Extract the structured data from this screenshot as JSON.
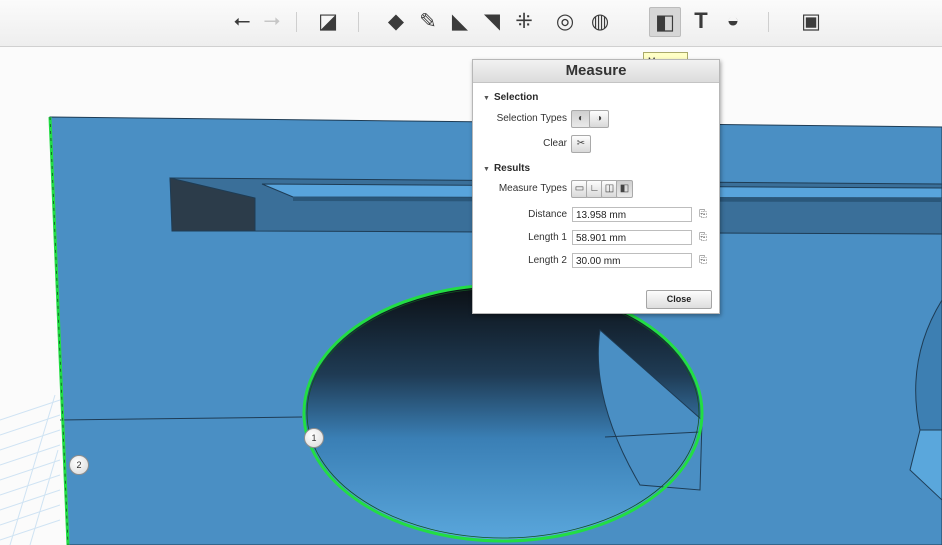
{
  "toolbar": {
    "items": [
      {
        "name": "undo-button",
        "glyph": "⭠",
        "state": "normal"
      },
      {
        "name": "redo-button",
        "glyph": "⭢",
        "state": "disabled"
      },
      {
        "name": "primitives-button",
        "glyph": "◪",
        "state": "normal"
      },
      {
        "name": "sketch-button",
        "glyph": "◆",
        "state": "normal"
      },
      {
        "name": "construct-button",
        "glyph": "✎",
        "state": "normal"
      },
      {
        "name": "modify-button",
        "glyph": "◣",
        "state": "normal"
      },
      {
        "name": "pattern-button",
        "glyph": "◥",
        "state": "normal"
      },
      {
        "name": "grouping-button",
        "glyph": "⁜",
        "state": "normal"
      },
      {
        "name": "combine-button",
        "glyph": "◎",
        "state": "normal"
      },
      {
        "name": "materials-button",
        "glyph": "◍",
        "state": "normal"
      },
      {
        "name": "measure-button",
        "glyph": "◧",
        "state": "active"
      },
      {
        "name": "text-button",
        "glyph": "T",
        "state": "normal"
      },
      {
        "name": "snap-button",
        "glyph": "◒",
        "state": "normal"
      },
      {
        "name": "view-cube-button",
        "glyph": "▣",
        "state": "normal"
      }
    ]
  },
  "tooltip": "Measure",
  "panel": {
    "title": "Measure",
    "selection_heading": "Selection",
    "selection_types_label": "Selection Types",
    "clear_label": "Clear",
    "results_heading": "Results",
    "measure_types_label": "Measure Types",
    "distance_label": "Distance",
    "distance_value": "13.958 mm",
    "length1_label": "Length 1",
    "length1_value": "58.901 mm",
    "length2_label": "Length 2",
    "length2_value": "30.00 mm",
    "close_label": "Close"
  },
  "markers": {
    "m1": "1",
    "m2": "2"
  },
  "colors": {
    "model_face": "#4a8fc4",
    "selection_highlight": "#22dd44",
    "accent": "#d6d6d6"
  }
}
